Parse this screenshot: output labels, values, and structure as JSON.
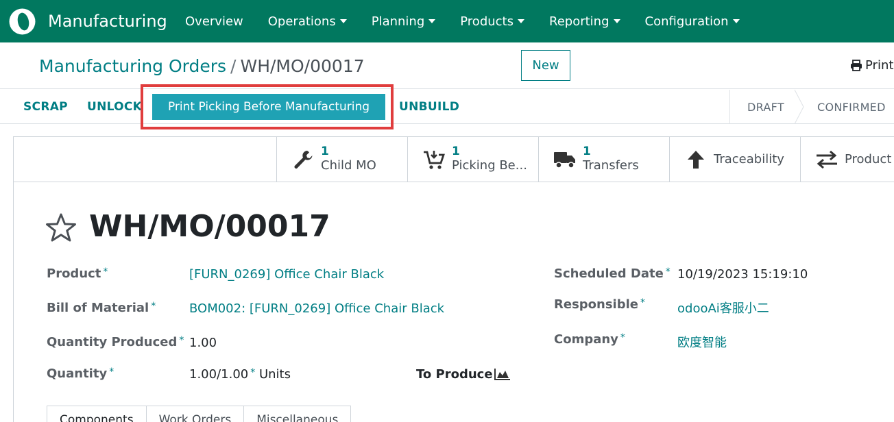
{
  "navbar": {
    "app_title": "Manufacturing",
    "menu": [
      {
        "label": "Overview",
        "dropdown": false
      },
      {
        "label": "Operations",
        "dropdown": true
      },
      {
        "label": "Planning",
        "dropdown": true
      },
      {
        "label": "Products",
        "dropdown": true
      },
      {
        "label": "Reporting",
        "dropdown": true
      },
      {
        "label": "Configuration",
        "dropdown": true
      }
    ],
    "color": "#01785f"
  },
  "breadcrumb": {
    "parent": "Manufacturing Orders",
    "separator": "/",
    "current": "WH/MO/00017"
  },
  "control": {
    "new_label": "New",
    "print_label": "Print"
  },
  "statusbar": {
    "buttons": [
      "SCRAP",
      "UNLOCK",
      "UNBUILD"
    ],
    "primary_button": "Print Picking Before Manufacturing",
    "stages": [
      "DRAFT",
      "CONFIRMED"
    ],
    "highlight_color": "#e03d3d"
  },
  "smart_buttons": [
    {
      "icon": "wrench-icon",
      "value": "1",
      "label": "Child MO"
    },
    {
      "icon": "cart-download-icon",
      "value": "1",
      "label": "Picking Be..."
    },
    {
      "icon": "truck-icon",
      "value": "1",
      "label": "Transfers"
    },
    {
      "icon": "arrow-up-icon",
      "value": "",
      "label": "Traceability"
    },
    {
      "icon": "exchange-icon",
      "value": "",
      "label": "Product I"
    }
  ],
  "record": {
    "title": "WH/MO/00017",
    "fields": {
      "product": {
        "label": "Product",
        "required": "*",
        "value": "[FURN_0269] Office Chair Black"
      },
      "bom": {
        "label": "Bill of Material",
        "required": "*",
        "value": "BOM002: [FURN_0269] Office Chair Black"
      },
      "qty_produced": {
        "label": "Quantity Produced",
        "required": "*",
        "value": "1.00"
      },
      "quantity": {
        "label": "Quantity",
        "required": "*",
        "value": "1.00/1.00",
        "unit": "Units"
      },
      "to_produce": {
        "label": "To Produce"
      },
      "scheduled_date": {
        "label": "Scheduled Date",
        "required": "*",
        "value": "10/19/2023 15:19:10"
      },
      "responsible": {
        "label": "Responsible",
        "required": "*",
        "value": "odooAi客服小二"
      },
      "company": {
        "label": "Company",
        "required": "*",
        "value": "欧度智能"
      }
    }
  },
  "tabs": [
    "Components",
    "Work Orders",
    "Miscellaneous"
  ]
}
